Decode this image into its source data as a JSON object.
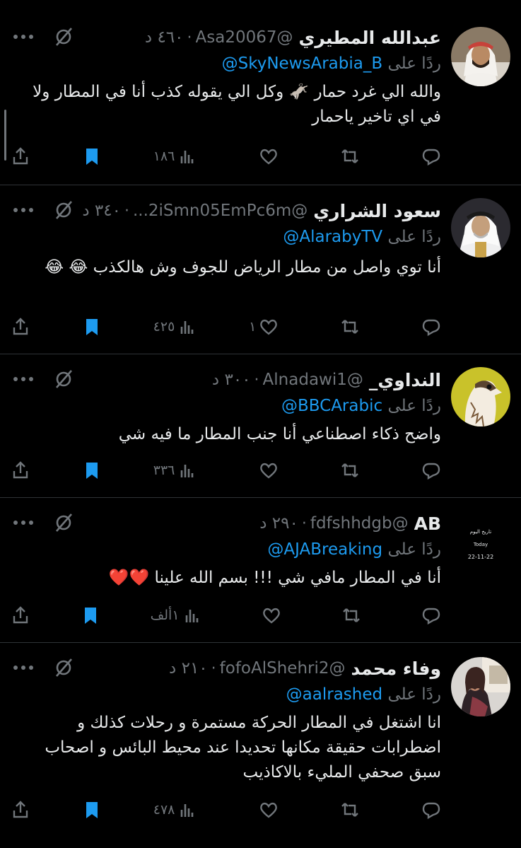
{
  "colors": {
    "background": "#000000",
    "text": "#e7e9ea",
    "muted": "#71767b",
    "link": "#1d9bf0",
    "bookmark": "#1d9bf0"
  },
  "reply_prefix": "ردًا على",
  "tweets": [
    {
      "name": "عبدالله المطيري",
      "handle": "@Asa20067",
      "time": "٤٦٠ د",
      "reply_to": "@SkyNewsArabia_B",
      "text": "والله الي غرد حمار 🫏 وكل الي يقوله كذب أنا في المطار ولا في اي تاخير ياحمار",
      "replies": "",
      "retweets": "",
      "likes": "",
      "views": "١٨٦",
      "avatar_icon": "man-ghutra-avatar"
    },
    {
      "name": "سعود الشراري",
      "handle": "@2iSmn05EmPc6m...",
      "time": "٣٤٠ د",
      "reply_to": "@AlarabyTV",
      "text": "أنا توي واصل من مطار الرياض للجوف وش هالكذب 😂 😂",
      "replies": "",
      "retweets": "",
      "likes": "١",
      "views": "٤٢٥",
      "avatar_icon": "elder-avatar"
    },
    {
      "name": "النداوي_",
      "handle": "@Alnadawi1",
      "time": "٣٠٠ د",
      "reply_to": "@BBCArabic",
      "text": "واضح ذكاء اصطناعي أنا جنب المطار ما فيه شي",
      "replies": "",
      "retweets": "",
      "likes": "",
      "views": "٣٣٦",
      "avatar_icon": "falcon-avatar"
    },
    {
      "name": "AB",
      "handle": "@fdfshhdgb",
      "time": "٢٩٠ د",
      "reply_to": "@AJABreaking",
      "text": "أنا في المطار مافي شي !!! بسم الله علينا ❤️❤️",
      "replies": "",
      "retweets": "",
      "likes": "",
      "views": "١ألف",
      "avatar_icon": "date-card-avatar",
      "avatar_text": {
        "line1": "تاريخ اليوم",
        "line2": "Today",
        "line3": "22-11-22"
      }
    },
    {
      "name": "وفاء محمد",
      "handle": "@fofoAlShehri2",
      "time": "٢١٠ د",
      "reply_to": "@aalrashed",
      "text": "انا اشتغل في المطار الحركة مستمرة و رحلات كذلك و اضطرابات حقيقة مكانها تحديدا عند محيط البائس و اصحاب سبق صحفي المليء بالاكاذيب",
      "replies": "",
      "retweets": "",
      "likes": "",
      "views": "٤٧٨",
      "avatar_icon": "woman-car-avatar"
    }
  ]
}
